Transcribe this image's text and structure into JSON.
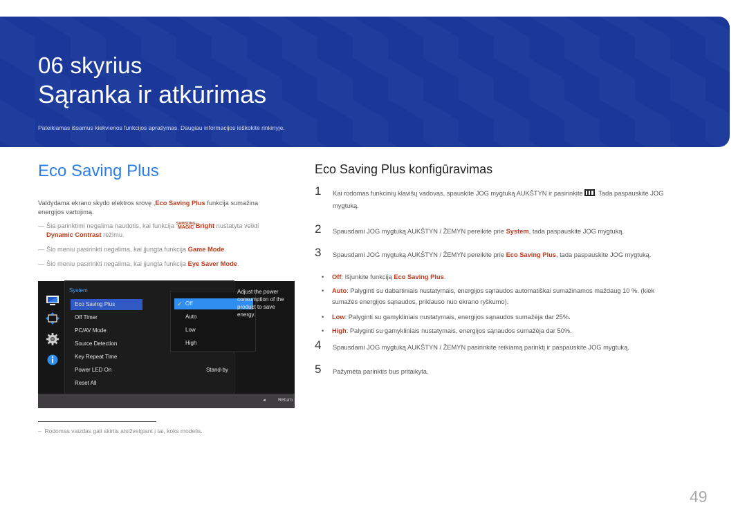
{
  "banner": {
    "chapter": "06 skyrius",
    "title": "Sąranka ir atkūrimas",
    "description": "Pateikiamas išsamus kiekvienos funkcijos aprašymas. Daugiau informacijos ieškokite rinkinyje.",
    "background_color": "#1f3d9c"
  },
  "left": {
    "section_title": "Eco Saving Plus",
    "intro_before": "Valdydama ekrano skydo elektros srovę ,",
    "intro_highlight": "Eco Saving Plus",
    "intro_after": " funkcija sumažina energijos vartojimą.",
    "notes": [
      {
        "before": "Šia parinktimi negalima naudotis, kai funkcija ",
        "logo_top": "SAMSUNG",
        "logo_bottom": "MAGIC",
        "logo_word": "Bright",
        "middle": " nustatyta veikti ",
        "highlight": "Dynamic Contrast",
        "after": " režimu."
      },
      {
        "before": "Šio meniu pasirinkti negalima, kai įjungta funkcija ",
        "highlight": "Game Mode",
        "after": "."
      },
      {
        "before": "Šio meniu pasirinkti negalima, kai įjungta funkcija ",
        "highlight": "Eye Saver Mode",
        "after": "."
      }
    ],
    "footnote": "Rodomas vaizdas gali skirtis atsižvelgiant į tai, koks modelis."
  },
  "osd": {
    "side_icons": [
      "picture-icon",
      "onscreen-display-icon",
      "system-gear-icon",
      "information-icon"
    ],
    "menu_title": "System",
    "menu_items": [
      "Eco Saving Plus",
      "Off Timer",
      "PC/AV Mode",
      "Source Detection",
      "Key Repeat Time",
      "Power LED On",
      "Reset All"
    ],
    "selected_item": "Eco Saving Plus",
    "power_led_value": "Stand-by",
    "options": [
      "Off",
      "Auto",
      "Low",
      "High"
    ],
    "selected_option": "Off",
    "help_text": "Adjust the power consumption of the product to save energy.",
    "footer_return": "Return",
    "footer_arrow": "◄"
  },
  "right": {
    "section_title": "Eco Saving Plus konfigūravimas",
    "steps": [
      {
        "num": "1",
        "before": "Kai rodomas funkcinių klavišų vadovas, spauskite JOG mygtuką AUKŠTYN ir pasirinkite ",
        "after": ". Tada paspauskite JOG mygtuką."
      },
      {
        "num": "2",
        "before": "Spausdami JOG mygtuką AUKŠTYN / ŽEMYN pereikite prie ",
        "highlight": "System",
        "after": ", tada paspauskite JOG mygtuką."
      },
      {
        "num": "3",
        "before": "Spausdami JOG mygtuką AUKŠTYN / ŽEMYN pereikite prie ",
        "highlight": "Eco Saving Plus",
        "after": ", tada paspauskite JOG mygtuką."
      },
      {
        "num": "4",
        "before": "Spausdami JOG mygtuką AUKŠTYN / ŽEMYN pasirinkite reikiamą parinktį ir paspauskite JOG mygtuką."
      },
      {
        "num": "5",
        "before": "Pažymėta parinktis bus pritaikyta."
      }
    ],
    "bullets": [
      {
        "label": "Off",
        "text": ": Išjunkite funkciją ",
        "highlight": "Eco Saving Plus",
        "after": "."
      },
      {
        "label": "Auto",
        "text": ": Palyginti su dabartiniais nustatymais, energijos sąnaudos automatiškai sumažinamos maždaug 10 %. (kiek sumažės energijos sąnaudos, priklauso nuo ekrano ryškumo)."
      },
      {
        "label": "Low",
        "text": ": Palyginti su gamykliniais nustatymais, energijos sąnaudos sumažėja dar 25%."
      },
      {
        "label": "High",
        "text": ": Palyginti su gamykliniais nustatymais, energijos sąnaudos sumažėja dar 50%."
      }
    ],
    "bullet_char": "•"
  },
  "page_number": "49",
  "colors": {
    "accent_blue": "#2b7de9",
    "highlight_red": "#c0391b"
  }
}
